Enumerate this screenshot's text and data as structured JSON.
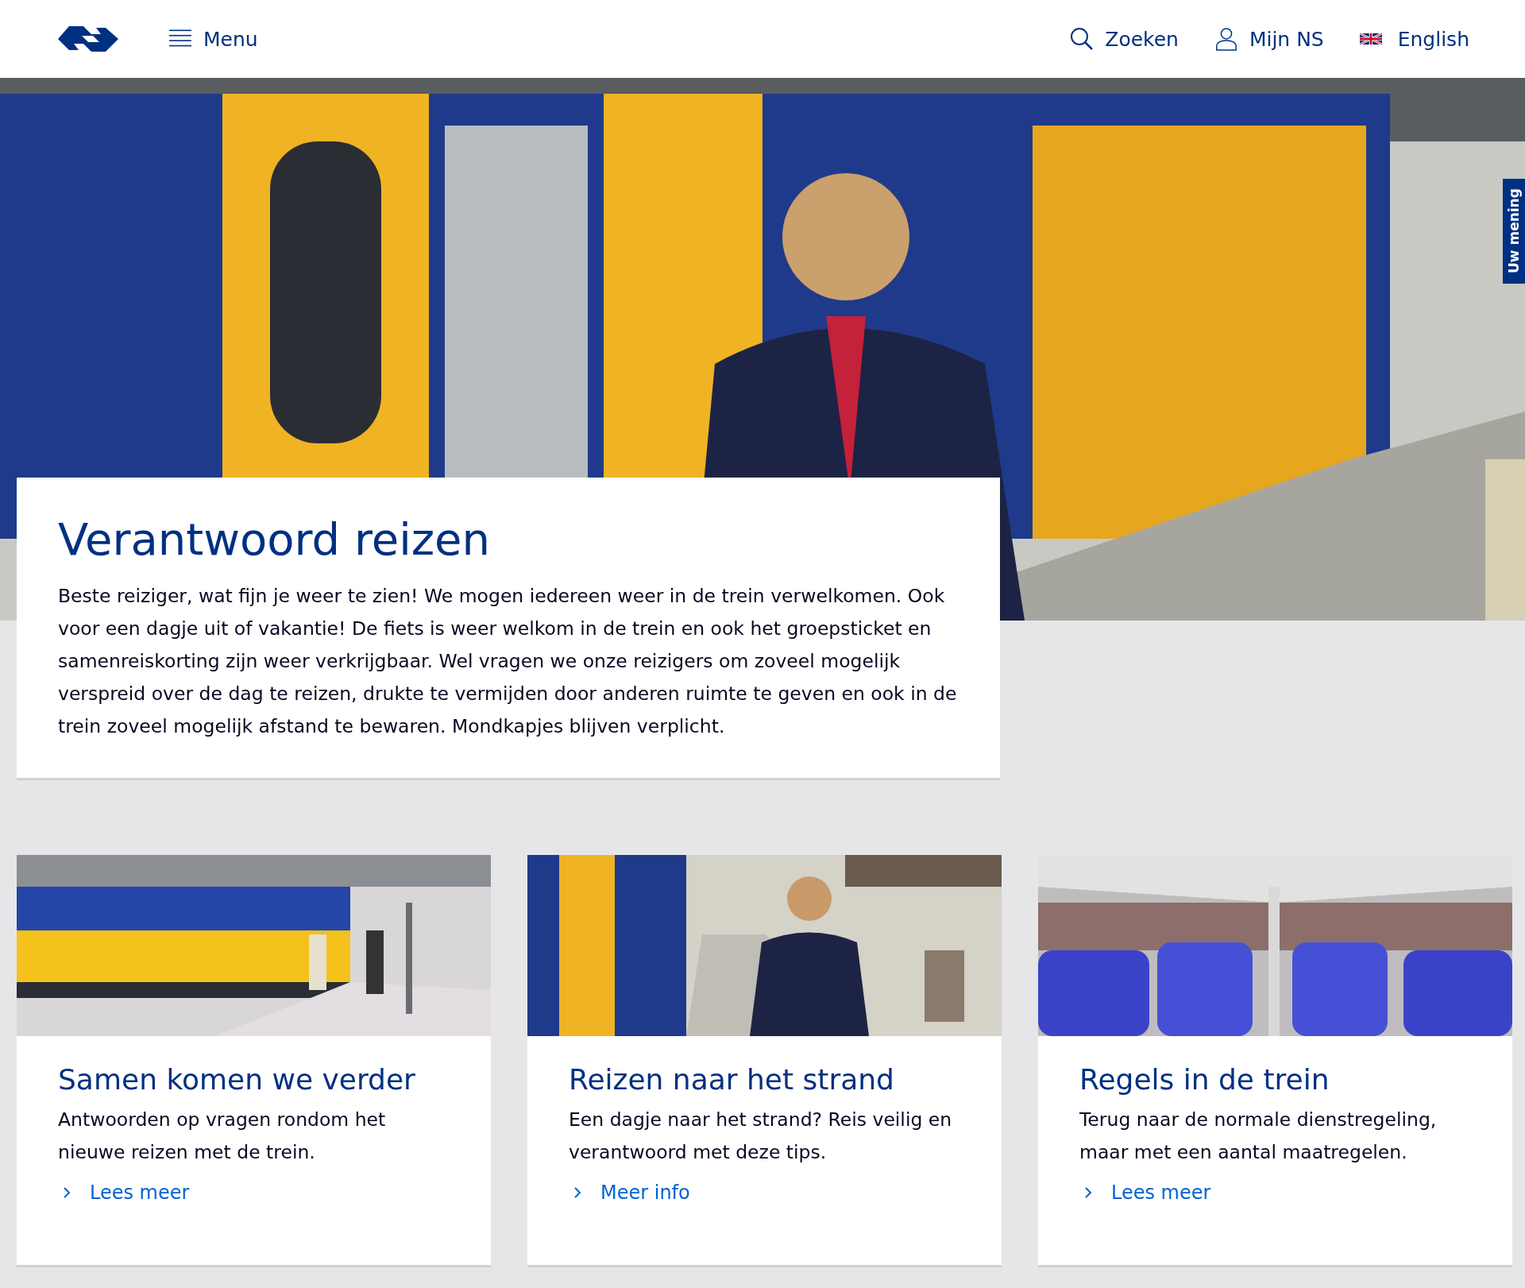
{
  "header": {
    "menu": "Menu",
    "search": "Zoeken",
    "account": "Mijn NS",
    "language": "English"
  },
  "feedback_tab": "Uw mening",
  "hero": {
    "title": "Verantwoord reizen",
    "text": "Beste reiziger, wat fijn je weer te zien! We mogen iedereen weer in de trein verwelkomen. Ook voor een dagje uit of vakantie! De fiets is weer welkom in de trein en ook het groepsticket en samenreiskorting zijn weer verkrijgbaar. Wel vragen we onze reizigers om zoveel mogelijk verspreid over de dag te reizen, drukte te vermijden door anderen ruimte te geven en ook in de trein zoveel mogelijk afstand te bewaren. Mondkapjes blijven verplicht."
  },
  "cards": [
    {
      "kind": "platform",
      "title": "Samen komen we verder",
      "text": "Antwoorden op vragen rondom het nieuwe reizen met de trein.",
      "link": "Lees meer"
    },
    {
      "kind": "conductor",
      "title": "Reizen naar het strand",
      "text": "Een dagje naar het strand? Reis veilig en verantwoord met deze tips.",
      "link": "Meer info"
    },
    {
      "kind": "interior",
      "title": "Regels in de trein",
      "text": "Terug naar de normale dienstregeling, maar met een aantal maatregelen.",
      "link": "Lees meer"
    }
  ]
}
